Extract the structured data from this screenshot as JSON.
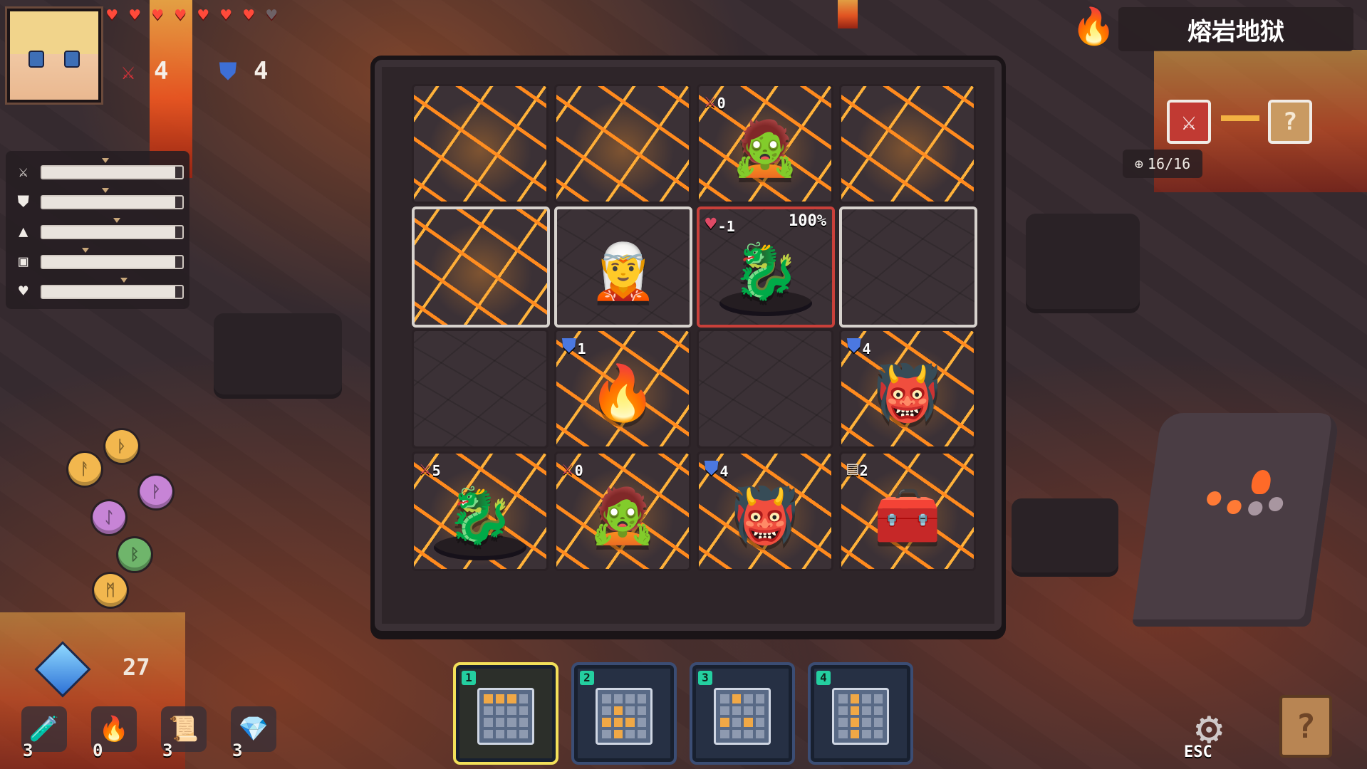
{
  "player": {
    "hearts_full": 7,
    "hearts_empty": 1,
    "attack": "4",
    "defense": "4"
  },
  "stat_bars": [
    {
      "icon": "sword-icon",
      "fill": 0.95
    },
    {
      "icon": "shield-icon",
      "fill": 0.95
    },
    {
      "icon": "boot-icon",
      "fill": 0.95
    },
    {
      "icon": "chest-icon",
      "fill": 0.95
    },
    {
      "icon": "heart-icon",
      "fill": 0.95
    }
  ],
  "runes": [
    {
      "letter": "ᚦ",
      "color": "#f2b74e"
    },
    {
      "letter": "ᚨ",
      "color": "#f2b74e"
    },
    {
      "letter": "ᚹ",
      "color": "#c784d6"
    },
    {
      "letter": "ᛇ",
      "color": "#c784d6"
    },
    {
      "letter": "ᛒ",
      "color": "#6fb56b"
    },
    {
      "letter": "ᛗ",
      "color": "#f2b74e"
    }
  ],
  "crystals": "27",
  "items": [
    {
      "name": "red-potion",
      "glyph": "🧪",
      "count": "3"
    },
    {
      "name": "torch",
      "glyph": "🔥",
      "count": "0"
    },
    {
      "name": "scroll",
      "glyph": "📜",
      "count": "3"
    },
    {
      "name": "purple-gem",
      "glyph": "💎",
      "count": "3"
    }
  ],
  "area": {
    "name": "熔岩地狱",
    "zoom": "16/16"
  },
  "board": [
    [
      {
        "lava": true,
        "entity": ""
      },
      {
        "lava": true,
        "entity": ""
      },
      {
        "lava": true,
        "entity": "🧟",
        "badge_icon": "⚔",
        "badge_value": "0",
        "badge_color": "#e04a66"
      },
      {
        "lava": true,
        "entity": ""
      }
    ],
    [
      {
        "lava": true,
        "entity": "",
        "selected": true
      },
      {
        "lava": false,
        "entity": "🧝",
        "selected": true
      },
      {
        "lava": false,
        "entity": "🐉",
        "target": true,
        "pedestal": true,
        "badge_icon": "♥",
        "badge_value": "-1",
        "badge_color": "#e04a66",
        "pct": "100%"
      },
      {
        "lava": false,
        "entity": "",
        "selected": true
      }
    ],
    [
      {
        "lava": false,
        "entity": ""
      },
      {
        "lava": true,
        "entity": "🔥",
        "badge_icon": "⛊",
        "badge_value": "1",
        "badge_color": "#4b78e0"
      },
      {
        "lava": false,
        "entity": ""
      },
      {
        "lava": true,
        "entity": "👹",
        "badge_icon": "⛊",
        "badge_value": "4",
        "badge_color": "#4b78e0"
      }
    ],
    [
      {
        "lava": true,
        "entity": "🐉",
        "pedestal": true,
        "badge_icon": "⚔",
        "badge_value": "5",
        "badge_color": "#e04a66"
      },
      {
        "lava": true,
        "entity": "🧟",
        "badge_icon": "⚔",
        "badge_value": "0",
        "badge_color": "#e04a66"
      },
      {
        "lava": true,
        "entity": "👹",
        "badge_icon": "⛊",
        "badge_value": "4",
        "badge_color": "#4b78e0"
      },
      {
        "lava": true,
        "entity": "🧰",
        "badge_icon": "▤",
        "badge_value": "2",
        "badge_color": "#d9cfc3"
      }
    ]
  ],
  "layouts": [
    {
      "num": "1",
      "active": true,
      "pattern": [
        1,
        1,
        1,
        0,
        0,
        0,
        0,
        0,
        0,
        0,
        0,
        0,
        0,
        0,
        0,
        0
      ]
    },
    {
      "num": "2",
      "active": false,
      "pattern": [
        0,
        0,
        0,
        0,
        0,
        1,
        0,
        0,
        1,
        1,
        1,
        0,
        0,
        1,
        0,
        0
      ]
    },
    {
      "num": "3",
      "active": false,
      "pattern": [
        0,
        1,
        0,
        0,
        0,
        0,
        0,
        0,
        1,
        0,
        1,
        0,
        0,
        0,
        0,
        0
      ]
    },
    {
      "num": "4",
      "active": false,
      "pattern": [
        0,
        1,
        0,
        0,
        0,
        1,
        0,
        0,
        0,
        1,
        0,
        0,
        0,
        1,
        0,
        0
      ]
    }
  ],
  "controls": {
    "esc_label": "ESC",
    "help_glyph": "?"
  },
  "sequence": {
    "next_glyph": "?"
  }
}
